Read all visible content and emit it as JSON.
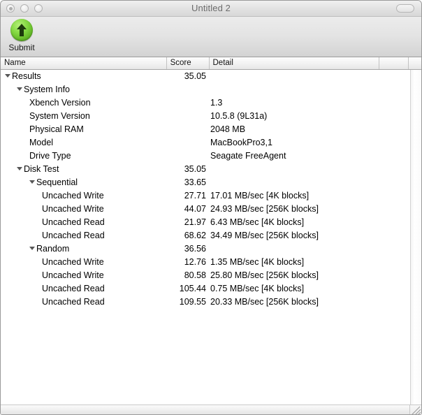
{
  "window": {
    "title": "Untitled 2",
    "controls": [
      "close-button",
      "minimize-button",
      "zoom-button"
    ],
    "toolbar_toggle": "toolbar-toggle-button"
  },
  "toolbar": {
    "items": [
      {
        "label": "Submit",
        "icon": "upload-arrow-icon",
        "color": "#6cc62b"
      }
    ]
  },
  "table": {
    "columns": [
      {
        "key": "name",
        "label": "Name"
      },
      {
        "key": "score",
        "label": "Score"
      },
      {
        "key": "detail",
        "label": "Detail"
      },
      {
        "key": "extra",
        "label": ""
      },
      {
        "key": "corner",
        "label": ""
      }
    ],
    "rows": [
      {
        "indent": 0,
        "expander": true,
        "name": "Results",
        "score": "35.05",
        "detail": ""
      },
      {
        "indent": 1,
        "expander": true,
        "name": "System Info",
        "score": "",
        "detail": ""
      },
      {
        "indent": 2,
        "expander": false,
        "name": "Xbench Version",
        "score": "",
        "detail": "1.3"
      },
      {
        "indent": 2,
        "expander": false,
        "name": "System Version",
        "score": "",
        "detail": "10.5.8 (9L31a)"
      },
      {
        "indent": 2,
        "expander": false,
        "name": "Physical RAM",
        "score": "",
        "detail": "2048 MB"
      },
      {
        "indent": 2,
        "expander": false,
        "name": "Model",
        "score": "",
        "detail": "MacBookPro3,1"
      },
      {
        "indent": 2,
        "expander": false,
        "name": "Drive Type",
        "score": "",
        "detail": "Seagate FreeAgent"
      },
      {
        "indent": 1,
        "expander": true,
        "name": "Disk Test",
        "score": "35.05",
        "detail": ""
      },
      {
        "indent": 2,
        "expander": true,
        "name": "Sequential",
        "score": "33.65",
        "detail": ""
      },
      {
        "indent": 3,
        "expander": false,
        "name": "Uncached Write",
        "score": "27.71",
        "detail": "17.01 MB/sec [4K blocks]"
      },
      {
        "indent": 3,
        "expander": false,
        "name": "Uncached Write",
        "score": "44.07",
        "detail": "24.93 MB/sec [256K blocks]"
      },
      {
        "indent": 3,
        "expander": false,
        "name": "Uncached Read",
        "score": "21.97",
        "detail": "6.43 MB/sec [4K blocks]"
      },
      {
        "indent": 3,
        "expander": false,
        "name": "Uncached Read",
        "score": "68.62",
        "detail": "34.49 MB/sec [256K blocks]"
      },
      {
        "indent": 2,
        "expander": true,
        "name": "Random",
        "score": "36.56",
        "detail": ""
      },
      {
        "indent": 3,
        "expander": false,
        "name": "Uncached Write",
        "score": "12.76",
        "detail": "1.35 MB/sec [4K blocks]"
      },
      {
        "indent": 3,
        "expander": false,
        "name": "Uncached Write",
        "score": "80.58",
        "detail": "25.80 MB/sec [256K blocks]"
      },
      {
        "indent": 3,
        "expander": false,
        "name": "Uncached Read",
        "score": "105.44",
        "detail": "0.75 MB/sec [4K blocks]"
      },
      {
        "indent": 3,
        "expander": false,
        "name": "Uncached Read",
        "score": "109.55",
        "detail": "20.33 MB/sec [256K blocks]"
      }
    ]
  }
}
